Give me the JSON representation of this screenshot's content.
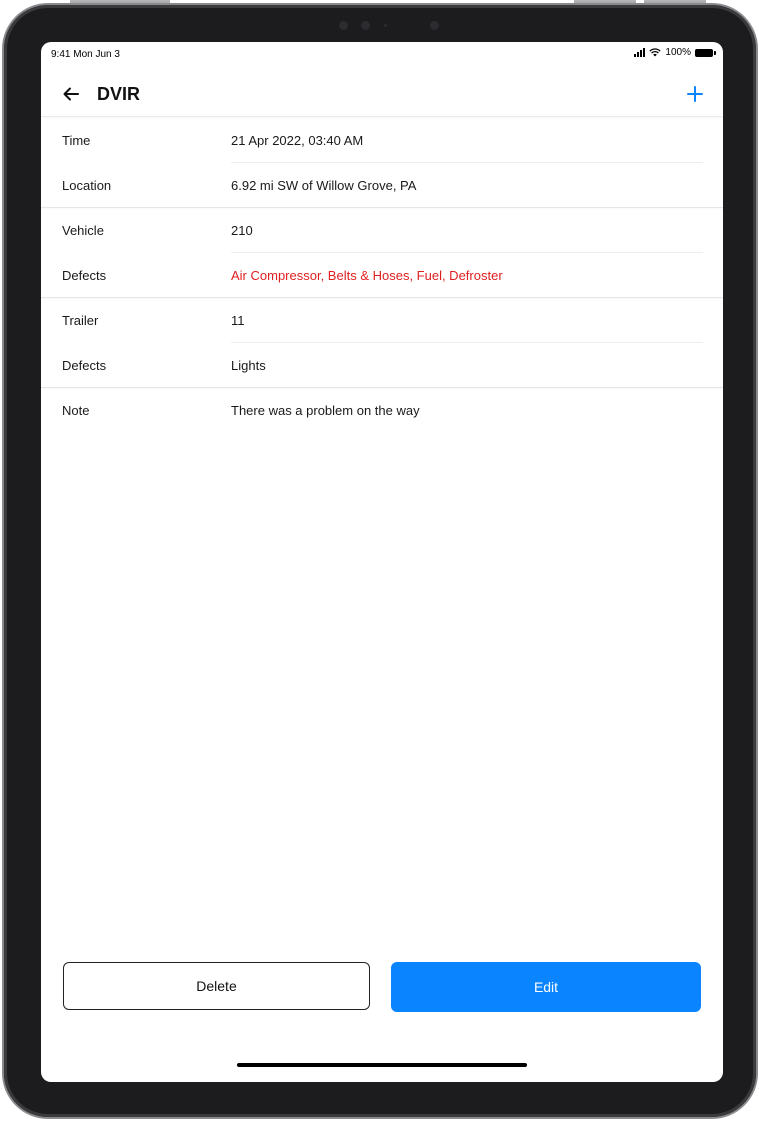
{
  "status_bar": {
    "time": "9:41 Mon Jun 3",
    "battery": "100%"
  },
  "nav": {
    "back_icon": "arrow-left-icon",
    "title": "DVIR",
    "add_icon": "plus-icon"
  },
  "details": {
    "time": {
      "label": "Time",
      "value": "21 Apr 2022, 03:40 AM"
    },
    "location": {
      "label": "Location",
      "value": "6.92 mi SW of Willow Grove, PA"
    },
    "vehicle": {
      "label": "Vehicle",
      "value": "210"
    },
    "vehicle_defects": {
      "label": "Defects",
      "value": "Air Compressor, Belts & Hoses, Fuel, Defroster"
    },
    "trailer": {
      "label": "Trailer",
      "value": "11"
    },
    "trailer_defects": {
      "label": "Defects",
      "value": "Lights"
    },
    "note": {
      "label": "Note",
      "value": "There was a problem on the way"
    }
  },
  "actions": {
    "delete_label": "Delete",
    "edit_label": "Edit"
  },
  "colors": {
    "accent": "#0a84ff",
    "defect_red": "#e02020"
  }
}
